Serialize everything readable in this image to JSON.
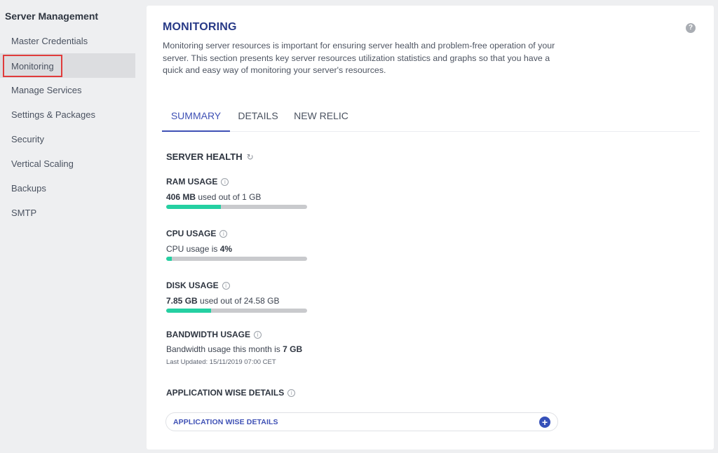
{
  "sidebar": {
    "title": "Server Management",
    "items": [
      {
        "label": "Master Credentials",
        "active": false
      },
      {
        "label": "Monitoring",
        "active": true
      },
      {
        "label": "Manage Services",
        "active": false
      },
      {
        "label": "Settings & Packages",
        "active": false
      },
      {
        "label": "Security",
        "active": false
      },
      {
        "label": "Vertical Scaling",
        "active": false
      },
      {
        "label": "Backups",
        "active": false
      },
      {
        "label": "SMTP",
        "active": false
      }
    ]
  },
  "header": {
    "title": "MONITORING",
    "help_glyph": "?",
    "description": "Monitoring server resources is important for ensuring server health and problem-free operation of your server. This section presents key server resources utilization statistics and graphs so that you have a quick and easy way of monitoring your server's resources."
  },
  "tabs": [
    {
      "label": "SUMMARY",
      "active": true
    },
    {
      "label": "DETAILS",
      "active": false
    },
    {
      "label": "NEW RELIC",
      "active": false
    }
  ],
  "server_health": {
    "title": "SERVER HEALTH",
    "refresh_glyph": "↻",
    "ram": {
      "title": "RAM USAGE",
      "value": "406 MB",
      "suffix": "used out of 1 GB",
      "fill_fraction": 0.39
    },
    "cpu": {
      "title": "CPU USAGE",
      "prefix": "CPU usage is",
      "value": "4%",
      "fill_fraction": 0.04
    },
    "disk": {
      "title": "DISK USAGE",
      "value": "7.85 GB",
      "suffix": "used out of 24.58 GB",
      "fill_fraction": 0.32
    },
    "bandwidth": {
      "title": "BANDWIDTH USAGE",
      "prefix": "Bandwidth usage this month is",
      "value": "7 GB",
      "last_updated": "Last Updated: 15/11/2019 07:00 CET"
    }
  },
  "application_details": {
    "title": "APPLICATION WISE DETAILS",
    "accordion_label": "APPLICATION WISE DETAILS",
    "plus_glyph": "+"
  },
  "icons": {
    "info_glyph": "i"
  },
  "colors": {
    "accent": "#3f51b5",
    "title": "#283a87",
    "bar_fill": "#25d0a2",
    "bar_track": "#c9cacd",
    "highlight_border": "#e03b3b"
  }
}
